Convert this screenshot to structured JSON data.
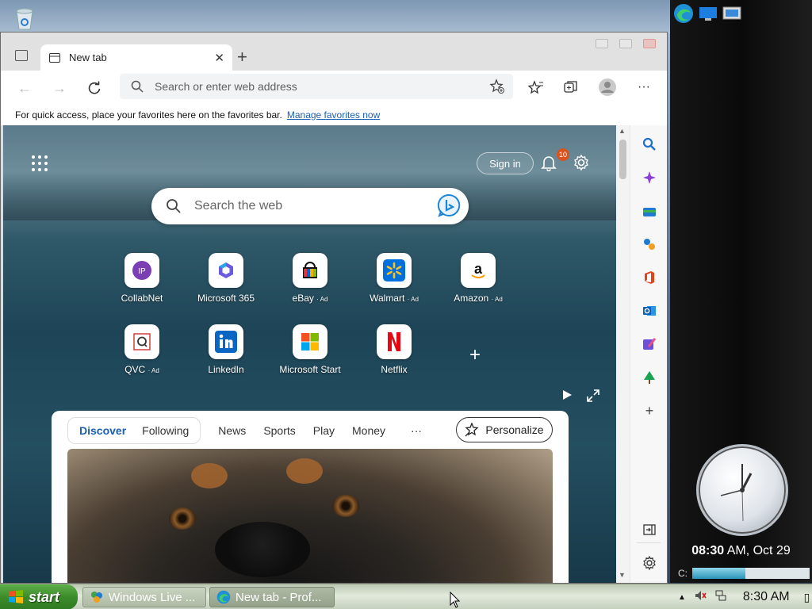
{
  "browser": {
    "tab": {
      "title": "New tab"
    },
    "address": {
      "placeholder": "Search or enter web address"
    },
    "favorites_bar": {
      "text": "For quick access, place your favorites here on the favorites bar.",
      "link": "Manage favorites now"
    }
  },
  "newtab": {
    "signin_label": "Sign in",
    "notification_count": "10",
    "search_placeholder": "Search the web",
    "tiles": [
      {
        "label": "CollabNet",
        "ad": "",
        "icon": "collabnet-icon"
      },
      {
        "label": "Microsoft 365",
        "ad": "",
        "icon": "microsoft-365-icon"
      },
      {
        "label": "eBay",
        "ad": "· Ad",
        "icon": "ebay-icon"
      },
      {
        "label": "Walmart",
        "ad": "· Ad",
        "icon": "walmart-icon"
      },
      {
        "label": "Amazon",
        "ad": "· Ad",
        "icon": "amazon-icon"
      },
      {
        "label": "QVC",
        "ad": "· Ad",
        "icon": "qvc-icon"
      },
      {
        "label": "LinkedIn",
        "ad": "",
        "icon": "linkedin-icon"
      },
      {
        "label": "Microsoft Start",
        "ad": "",
        "icon": "microsoft-start-icon"
      },
      {
        "label": "Netflix",
        "ad": "",
        "icon": "netflix-icon"
      }
    ],
    "feed": {
      "pill_tabs": [
        "Discover",
        "Following"
      ],
      "links": [
        "News",
        "Sports",
        "Play",
        "Money"
      ],
      "more": "···",
      "personalize": "Personalize"
    }
  },
  "gadgets": {
    "clock_time": "08:30",
    "clock_suffix": " AM, Oct 29",
    "disk_label": "C:",
    "disk_usage": 0.45
  },
  "taskbar": {
    "start_label": "start",
    "buttons": [
      "Windows Live ...",
      "New tab - Prof..."
    ],
    "time": "8:30 AM"
  },
  "colors": {
    "accent": "#1a5fb4",
    "start_green": "#3c8c2a",
    "badge": "#d9531e"
  }
}
